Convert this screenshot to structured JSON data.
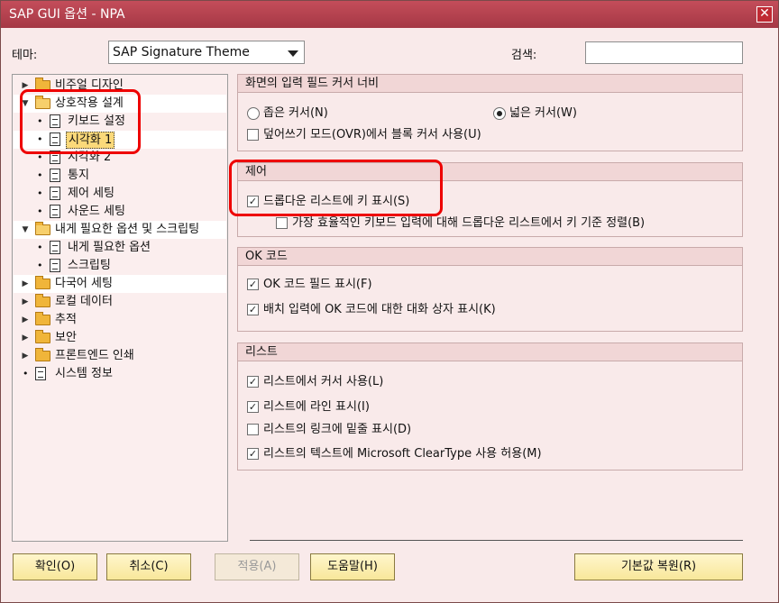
{
  "window": {
    "title": "SAP GUI 옵션 - NPA",
    "close_symbol": "✕"
  },
  "theme": {
    "label": "테마:",
    "value": "SAP Signature Theme"
  },
  "search": {
    "label": "검색:",
    "value": ""
  },
  "tree": {
    "items": [
      {
        "label": "비주얼 디자인",
        "kind": "folder",
        "expanded": false
      },
      {
        "label": "상호작용 설계",
        "kind": "folder",
        "expanded": true
      },
      {
        "label": "키보드 설정",
        "kind": "doc"
      },
      {
        "label": "시각화 1",
        "kind": "doc",
        "selected": true
      },
      {
        "label": "시각화 2",
        "kind": "doc"
      },
      {
        "label": "통지",
        "kind": "doc"
      },
      {
        "label": "제어 세팅",
        "kind": "doc"
      },
      {
        "label": "사운드 세팅",
        "kind": "doc"
      },
      {
        "label": "내게 필요한 옵션 및 스크립팅",
        "kind": "folder",
        "expanded": true
      },
      {
        "label": "내게 필요한 옵션",
        "kind": "doc"
      },
      {
        "label": "스크립팅",
        "kind": "doc"
      },
      {
        "label": "다국어 세팅",
        "kind": "folder",
        "expanded": false
      },
      {
        "label": "로컬 데이터",
        "kind": "folder",
        "expanded": false
      },
      {
        "label": "추적",
        "kind": "folder",
        "expanded": false
      },
      {
        "label": "보안",
        "kind": "folder",
        "expanded": false
      },
      {
        "label": "프론트엔드 인쇄",
        "kind": "folder",
        "expanded": false
      },
      {
        "label": "시스템 정보",
        "kind": "doc"
      }
    ]
  },
  "groups": {
    "cursor": {
      "title": "화면의 입력 필드 커서 너비",
      "narrow": {
        "label": "좁은 커서(N)",
        "checked": false
      },
      "wide": {
        "label": "넓은 커서(W)",
        "checked": true
      },
      "overwrite": {
        "label": "덮어쓰기 모드(OVR)에서 블록 커서 사용(U)",
        "checked": false
      }
    },
    "control": {
      "title": "제어",
      "show_key": {
        "label": "드롭다운 리스트에 키 표시(S)",
        "checked": true
      },
      "sort_key": {
        "label": "가장 효율적인 키보드 입력에 대해 드롭다운 리스트에서 키 기준 정렬(B)",
        "checked": false
      }
    },
    "okcode": {
      "title": "OK 코드",
      "show_field": {
        "label": "OK 코드 필드 표시(F)",
        "checked": true
      },
      "batch_dialog": {
        "label": "배치 입력에 OK 코드에 대한 대화 상자 표시(K)",
        "checked": true
      }
    },
    "list": {
      "title": "리스트",
      "cursor": {
        "label": "리스트에서 커서 사용(L)",
        "checked": true
      },
      "lines": {
        "label": "리스트에 라인 표시(I)",
        "checked": true
      },
      "underline": {
        "label": "리스트의 링크에 밑줄 표시(D)",
        "checked": false
      },
      "cleartype": {
        "label": "리스트의 텍스트에 Microsoft ClearType 사용 허용(M)",
        "checked": true
      }
    }
  },
  "buttons": {
    "ok": "확인(O)",
    "cancel": "취소(C)",
    "apply": "적용(A)",
    "help": "도움말(H)",
    "defaults": "기본값 복원(R)"
  },
  "check_mark": "✓",
  "colors": {
    "title_bar": "#b2404c",
    "highlight_annotation": "#e00000",
    "button_face": "#f8e79a"
  }
}
